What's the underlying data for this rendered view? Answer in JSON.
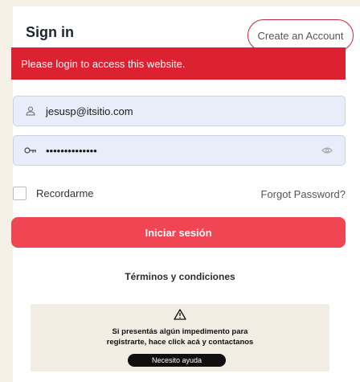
{
  "header": {
    "title": "Sign in",
    "create_account_label": "Create an Account"
  },
  "alert": {
    "message": "Please login to access this website.",
    "color": "#dc2230"
  },
  "form": {
    "email_value": "jesusp@itsitio.com",
    "password_value": "••••••••••••••",
    "remember_label": "Recordarme",
    "forgot_label": "Forgot Password?",
    "submit_label": "Iniciar sesión",
    "icons": [
      "user-icon",
      "key-icon",
      "eye-icon"
    ]
  },
  "terms_label": "Términos y condiciones",
  "help": {
    "line1": "Si presentás algún impedimento para",
    "line2": "registrarte, hace click acá y contactanos",
    "button_label": "Necesito ayuda",
    "icon": "warning-icon"
  },
  "colors": {
    "primary": "#f04654",
    "accent_border": "#c9283a",
    "background": "#f5f1e6"
  }
}
